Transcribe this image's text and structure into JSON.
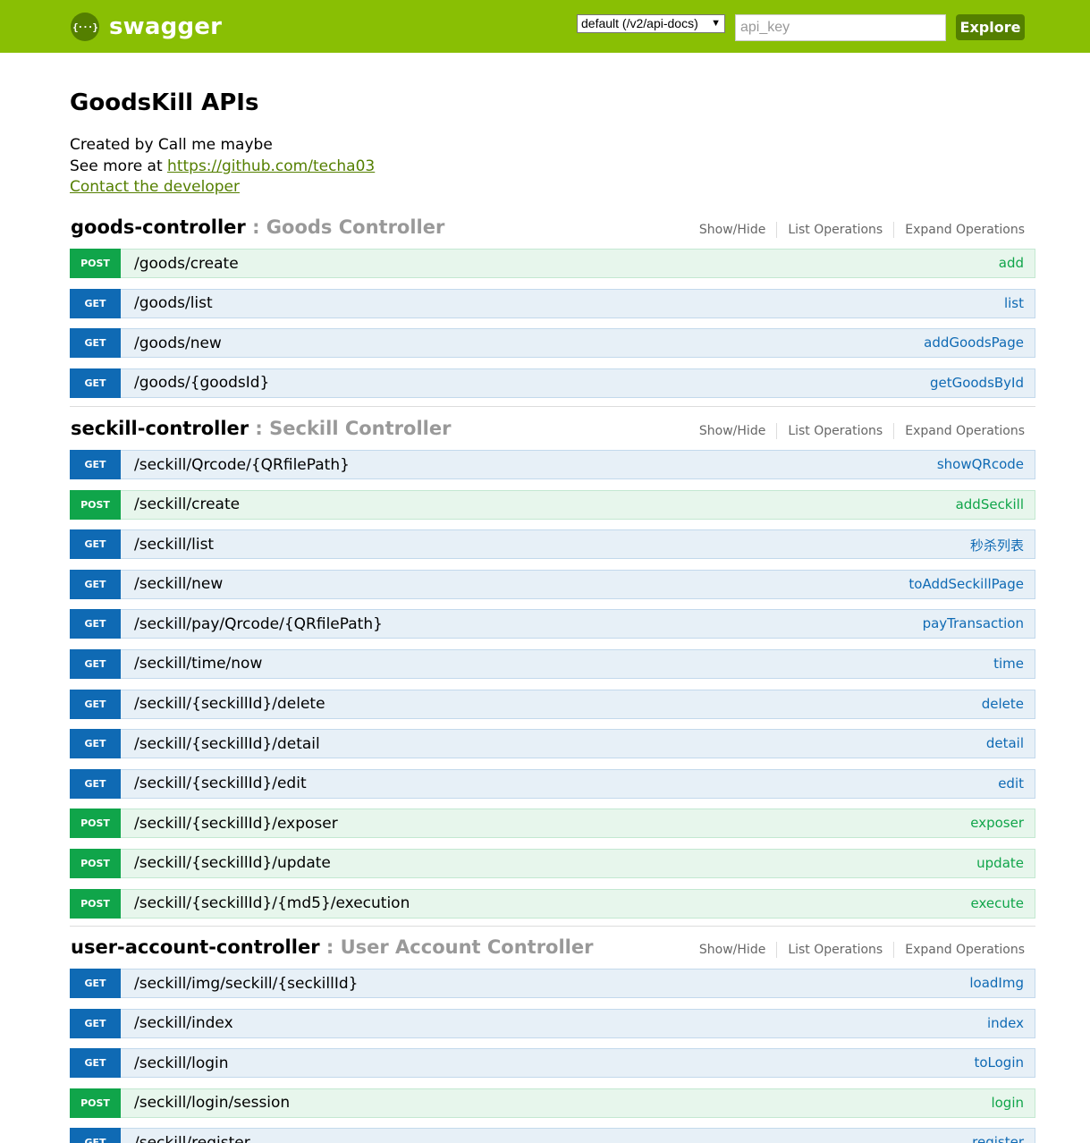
{
  "header": {
    "logo_text": "swagger",
    "logo_glyph": "{···}",
    "spec_select": "default (/v2/api-docs)",
    "api_key_placeholder": "api_key",
    "explore_label": "Explore",
    "background_color": "#89bf04"
  },
  "info": {
    "title": "GoodsKill APIs",
    "created_by": "Created by Call me maybe",
    "see_more_prefix": "See more at ",
    "see_more_link": "https://github.com/techa03",
    "contact": "Contact the developer"
  },
  "resources": [
    {
      "name": "goods-controller",
      "description": " : Goods Controller",
      "options": [
        "Show/Hide",
        "List Operations",
        "Expand Operations"
      ],
      "operations": [
        {
          "method": "POST",
          "path": "/goods/create",
          "summary": "add"
        },
        {
          "method": "GET",
          "path": "/goods/list",
          "summary": "list"
        },
        {
          "method": "GET",
          "path": "/goods/new",
          "summary": "addGoodsPage"
        },
        {
          "method": "GET",
          "path": "/goods/{goodsId}",
          "summary": "getGoodsById"
        }
      ]
    },
    {
      "name": "seckill-controller",
      "description": " : Seckill Controller",
      "options": [
        "Show/Hide",
        "List Operations",
        "Expand Operations"
      ],
      "operations": [
        {
          "method": "GET",
          "path": "/seckill/Qrcode/{QRfilePath}",
          "summary": "showQRcode"
        },
        {
          "method": "POST",
          "path": "/seckill/create",
          "summary": "addSeckill"
        },
        {
          "method": "GET",
          "path": "/seckill/list",
          "summary": "秒杀列表"
        },
        {
          "method": "GET",
          "path": "/seckill/new",
          "summary": "toAddSeckillPage"
        },
        {
          "method": "GET",
          "path": "/seckill/pay/Qrcode/{QRfilePath}",
          "summary": "payTransaction"
        },
        {
          "method": "GET",
          "path": "/seckill/time/now",
          "summary": "time"
        },
        {
          "method": "GET",
          "path": "/seckill/{seckillId}/delete",
          "summary": "delete"
        },
        {
          "method": "GET",
          "path": "/seckill/{seckillId}/detail",
          "summary": "detail"
        },
        {
          "method": "GET",
          "path": "/seckill/{seckillId}/edit",
          "summary": "edit"
        },
        {
          "method": "POST",
          "path": "/seckill/{seckillId}/exposer",
          "summary": "exposer"
        },
        {
          "method": "POST",
          "path": "/seckill/{seckillId}/update",
          "summary": "update"
        },
        {
          "method": "POST",
          "path": "/seckill/{seckillId}/{md5}/execution",
          "summary": "execute"
        }
      ]
    },
    {
      "name": "user-account-controller",
      "description": " : User Account Controller",
      "options": [
        "Show/Hide",
        "List Operations",
        "Expand Operations"
      ],
      "operations": [
        {
          "method": "GET",
          "path": "/seckill/img/seckill/{seckillId}",
          "summary": "loadImg"
        },
        {
          "method": "GET",
          "path": "/seckill/index",
          "summary": "index"
        },
        {
          "method": "GET",
          "path": "/seckill/login",
          "summary": "toLogin"
        },
        {
          "method": "POST",
          "path": "/seckill/login/session",
          "summary": "login"
        },
        {
          "method": "GET",
          "path": "/seckill/register",
          "summary": "register"
        }
      ]
    }
  ],
  "colors": {
    "get": "#0f6ab4",
    "post": "#10a54a",
    "get_bg": "#e7f0f7",
    "post_bg": "#e7f6ec",
    "link": "#547f00"
  }
}
